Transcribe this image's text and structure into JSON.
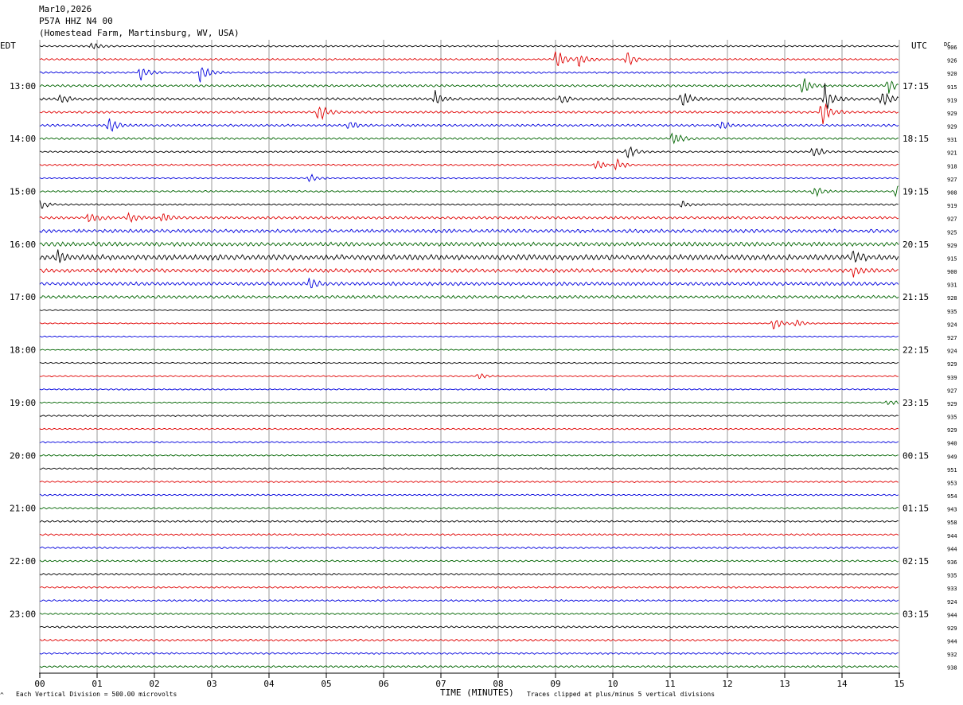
{
  "header": {
    "date": "Mar10,2026",
    "station": "P57A HHZ N4 00",
    "location": "(Homestead Farm, Martinsburg, WV, USA)"
  },
  "labels": {
    "left_tz": "EDT",
    "right_tz": "UTC",
    "dc_header": "DC",
    "xlabel": "TIME (MINUTES)",
    "scale_note": "Each Vertical Division =  500.00 microvolts",
    "clip_note": "Traces clipped at plus/minus 5 vertical divisions"
  },
  "colors": {
    "trace_cycle": [
      "#000000",
      "#e00000",
      "#0000dd",
      "#006400"
    ],
    "grid": "#999999"
  },
  "chart_data": {
    "type": "line",
    "title": "P57A HHZ N4 00",
    "xlabel": "TIME (MINUTES)",
    "xlim": [
      0,
      15
    ],
    "x_ticks": [
      "00",
      "01",
      "02",
      "03",
      "04",
      "05",
      "06",
      "07",
      "08",
      "09",
      "10",
      "11",
      "12",
      "13",
      "14",
      "15"
    ],
    "rows_per_hour": 4,
    "row_count": 48,
    "first_row_time_edt": "12:15",
    "left_time_labels": [
      {
        "row": 3,
        "label": "13:00"
      },
      {
        "row": 7,
        "label": "14:00"
      },
      {
        "row": 11,
        "label": "15:00"
      },
      {
        "row": 15,
        "label": "16:00"
      },
      {
        "row": 19,
        "label": "17:00"
      },
      {
        "row": 23,
        "label": "18:00"
      },
      {
        "row": 27,
        "label": "19:00"
      },
      {
        "row": 31,
        "label": "20:00"
      },
      {
        "row": 35,
        "label": "21:00"
      },
      {
        "row": 39,
        "label": "22:00"
      },
      {
        "row": 43,
        "label": "23:00"
      }
    ],
    "right_time_labels": [
      {
        "row": 3,
        "label": "17:15"
      },
      {
        "row": 7,
        "label": "18:15"
      },
      {
        "row": 11,
        "label": "19:15"
      },
      {
        "row": 15,
        "label": "20:15"
      },
      {
        "row": 19,
        "label": "21:15"
      },
      {
        "row": 23,
        "label": "22:15"
      },
      {
        "row": 27,
        "label": "23:15"
      },
      {
        "row": 31,
        "label": "00:15"
      },
      {
        "row": 35,
        "label": "01:15"
      },
      {
        "row": 39,
        "label": "02:15"
      },
      {
        "row": 43,
        "label": "03:15"
      }
    ],
    "dc_offsets": [
      "906",
      "926",
      "920",
      "915",
      "919",
      "929",
      "929",
      "931",
      "921",
      "918",
      "927",
      "908",
      "919",
      "927",
      "925",
      "929",
      "915",
      "900",
      "931",
      "928",
      "935",
      "924",
      "927",
      "924",
      "929",
      "939",
      "927",
      "929",
      "935",
      "929",
      "940",
      "949",
      "951",
      "953",
      "954",
      "943",
      "958",
      "944",
      "944",
      "936",
      "935",
      "933",
      "924",
      "944",
      "929",
      "944",
      "932",
      "938"
    ],
    "trace_amplitude_level": [
      0.6,
      0.6,
      0.6,
      0.8,
      0.9,
      0.8,
      0.8,
      0.7,
      0.6,
      0.6,
      0.5,
      0.6,
      0.6,
      0.9,
      1.2,
      1.4,
      1.8,
      1.3,
      1.2,
      1.0,
      0.4,
      0.4,
      0.4,
      0.4,
      0.45,
      0.45,
      0.45,
      0.45,
      0.5,
      0.5,
      0.5,
      0.5,
      0.55,
      0.55,
      0.55,
      0.55,
      0.6,
      0.6,
      0.6,
      0.6,
      0.6,
      0.6,
      0.6,
      0.6,
      0.65,
      0.65,
      0.65,
      0.65
    ],
    "events": [
      {
        "row": 0,
        "minute": 0.9,
        "amp": 1.2
      },
      {
        "row": 1,
        "minute": 9.0,
        "amp": 3.0
      },
      {
        "row": 1,
        "minute": 9.4,
        "amp": 2.5
      },
      {
        "row": 1,
        "minute": 10.25,
        "amp": 2.0
      },
      {
        "row": 2,
        "minute": 1.75,
        "amp": 2.5
      },
      {
        "row": 2,
        "minute": 2.8,
        "amp": 3.0
      },
      {
        "row": 3,
        "minute": 13.3,
        "amp": 3.0
      },
      {
        "row": 3,
        "minute": 14.8,
        "amp": 2.5
      },
      {
        "row": 4,
        "minute": 0.35,
        "amp": 1.5
      },
      {
        "row": 4,
        "minute": 6.9,
        "amp": 2.0
      },
      {
        "row": 4,
        "minute": 9.1,
        "amp": 1.5
      },
      {
        "row": 4,
        "minute": 11.2,
        "amp": 2.5
      },
      {
        "row": 4,
        "minute": 13.7,
        "amp": 4.0
      },
      {
        "row": 4,
        "minute": 14.7,
        "amp": 3.0
      },
      {
        "row": 5,
        "minute": 4.85,
        "amp": 3.0
      },
      {
        "row": 5,
        "minute": 13.65,
        "amp": 5.0
      },
      {
        "row": 6,
        "minute": 1.2,
        "amp": 2.5
      },
      {
        "row": 6,
        "minute": 5.4,
        "amp": 1.5
      },
      {
        "row": 6,
        "minute": 11.9,
        "amp": 1.2
      },
      {
        "row": 7,
        "minute": 11.05,
        "amp": 2.0
      },
      {
        "row": 8,
        "minute": 10.25,
        "amp": 2.2
      },
      {
        "row": 8,
        "minute": 13.5,
        "amp": 2.0
      },
      {
        "row": 9,
        "minute": 9.7,
        "amp": 1.8
      },
      {
        "row": 9,
        "minute": 10.05,
        "amp": 1.8
      },
      {
        "row": 10,
        "minute": 4.7,
        "amp": 1.2
      },
      {
        "row": 11,
        "minute": 13.5,
        "amp": 2.0
      },
      {
        "row": 11,
        "minute": 14.95,
        "amp": 2.2
      },
      {
        "row": 12,
        "minute": 0.0,
        "amp": 1.5
      },
      {
        "row": 12,
        "minute": 11.2,
        "amp": 1.2
      },
      {
        "row": 13,
        "minute": 0.85,
        "amp": 1.8
      },
      {
        "row": 13,
        "minute": 1.55,
        "amp": 1.8
      },
      {
        "row": 13,
        "minute": 2.15,
        "amp": 1.6
      },
      {
        "row": 16,
        "minute": 0.3,
        "amp": 2.0
      },
      {
        "row": 16,
        "minute": 14.2,
        "amp": 2.2
      },
      {
        "row": 17,
        "minute": 14.2,
        "amp": 1.5
      },
      {
        "row": 18,
        "minute": 4.7,
        "amp": 1.5
      },
      {
        "row": 21,
        "minute": 12.8,
        "amp": 2.0
      },
      {
        "row": 21,
        "minute": 13.2,
        "amp": 1.2
      },
      {
        "row": 25,
        "minute": 7.65,
        "amp": 1.0
      },
      {
        "row": 27,
        "minute": 14.8,
        "amp": 1.0
      }
    ]
  }
}
